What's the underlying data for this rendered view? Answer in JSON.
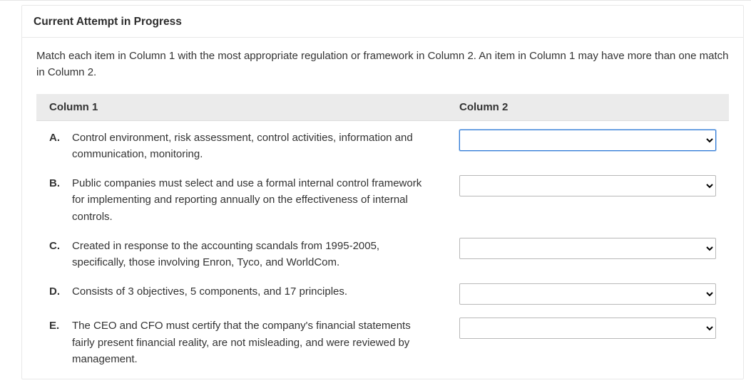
{
  "header_title": "Current Attempt in Progress",
  "instructions": "Match each item in Column 1 with the most appropriate regulation or framework in Column 2. An item in Column 1 may have more than one match in Column 2.",
  "columns": {
    "col1_label": "Column 1",
    "col2_label": "Column 2"
  },
  "rows": [
    {
      "letter": "A.",
      "text": "Control environment, risk assessment, control activities, information and communication, monitoring.",
      "selected": "",
      "focused": true
    },
    {
      "letter": "B.",
      "text": "Public companies must select and use a formal internal control framework for implementing and reporting annually on the effectiveness of internal controls.",
      "selected": "",
      "focused": false
    },
    {
      "letter": "C.",
      "text": "Created in response to the accounting scandals from 1995-2005, specifically, those involving Enron, Tyco, and WorldCom.",
      "selected": "",
      "focused": false
    },
    {
      "letter": "D.",
      "text": "Consists of 3 objectives, 5 components, and 17 principles.",
      "selected": "",
      "focused": false
    },
    {
      "letter": "E.",
      "text": "The CEO and CFO must certify that the company's financial statements fairly present financial reality, are not misleading, and were reviewed by management.",
      "selected": "",
      "focused": false
    }
  ]
}
